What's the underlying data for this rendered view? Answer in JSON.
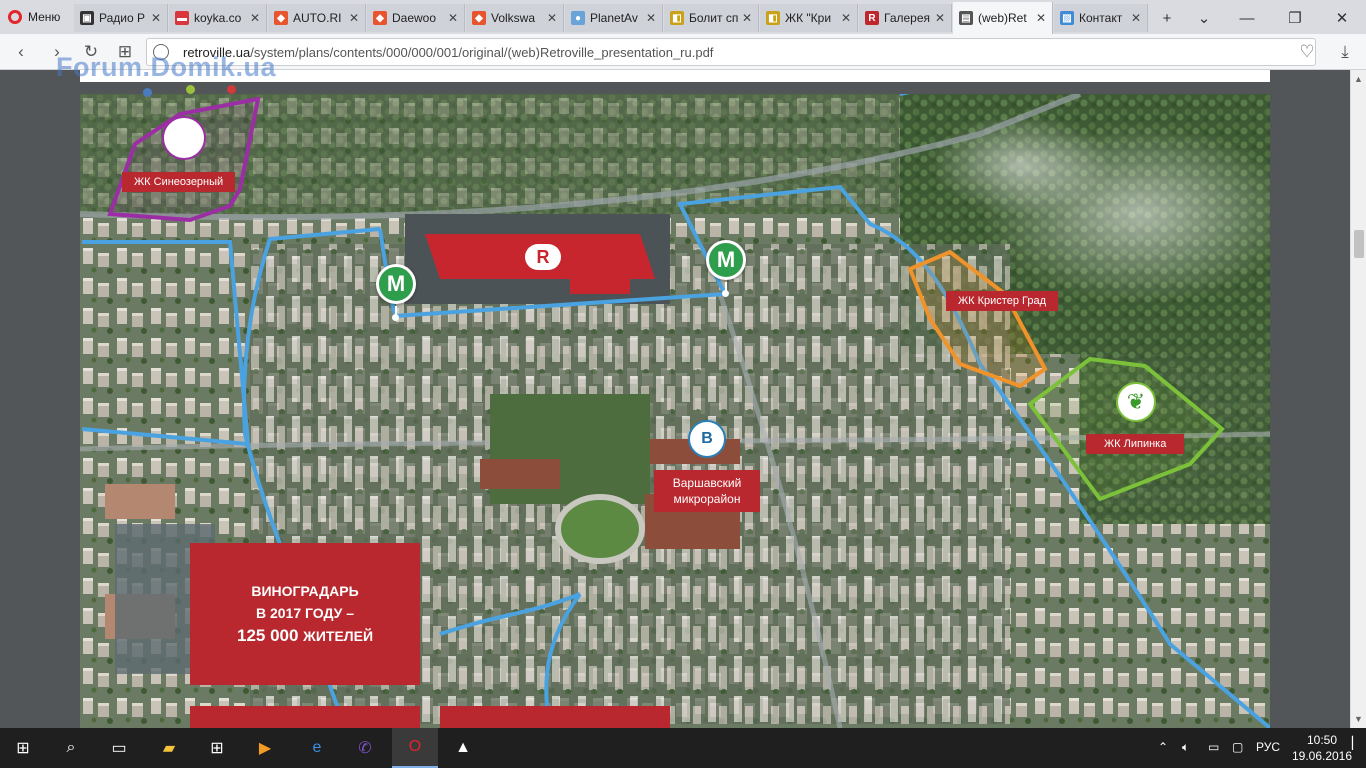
{
  "browser": {
    "menu_label": "Меню",
    "tabs": [
      {
        "label": "Радио Р",
        "color": "#333"
      },
      {
        "label": "koyka.co",
        "color": "#d9363e"
      },
      {
        "label": "AUTO.RI",
        "color": "#e8542e"
      },
      {
        "label": "Daewoo",
        "color": "#e8542e"
      },
      {
        "label": "Volkswa",
        "color": "#e8542e"
      },
      {
        "label": "PlanetAv",
        "color": "#6aa3d8"
      },
      {
        "label": "Болит сп",
        "color": "#c9a21a"
      },
      {
        "label": "ЖК \"Кри",
        "color": "#c9a21a"
      },
      {
        "label": "Галерея",
        "color": "#c0272d"
      },
      {
        "label": "(web)Ret",
        "color": "#555"
      },
      {
        "label": "Контакт",
        "color": "#3f8bd6"
      }
    ],
    "tab_favicon_letters": [
      "▣",
      "▬",
      "◆",
      "◆",
      "◆",
      "●",
      "◧",
      "◧",
      "R",
      "▤",
      "▨"
    ],
    "url_host": "retroville.ua",
    "url_path": "/system/plans/contents/000/000/001/original/(web)Retroville_presentation_ru.pdf"
  },
  "watermark": "Forum.Domik.ua",
  "map": {
    "labels": {
      "sinoozerny": "ЖК Синеозерный",
      "krister": "ЖК Кристер Град",
      "lipinka": "ЖК Липинка",
      "varshavsky": "Варшавский микрорайон",
      "varshavsky_line1": "Варшавский",
      "varshavsky_line2": "микрорайон"
    },
    "metro_letter": "M",
    "retroville_letter": "R",
    "lipinka_logo": "❦",
    "varshavsky_logo": "В",
    "info": {
      "line1": "ВИНОГРАДАРЬ",
      "line2": "В 2017 ГОДУ –",
      "line3_number": "125 000",
      "line3_word": "ЖИТЕЛЕЙ"
    }
  },
  "taskbar": {
    "language": "РУС",
    "time": "10:50",
    "date": "19.06.2016"
  },
  "colors": {
    "brand_red": "#b9282e",
    "metro_green": "#2e9d4c",
    "route_blue": "#4aa3e0",
    "purple_outline": "#9b2ea4",
    "orange_outline": "#f0932a",
    "green_outline": "#7cc13a"
  }
}
